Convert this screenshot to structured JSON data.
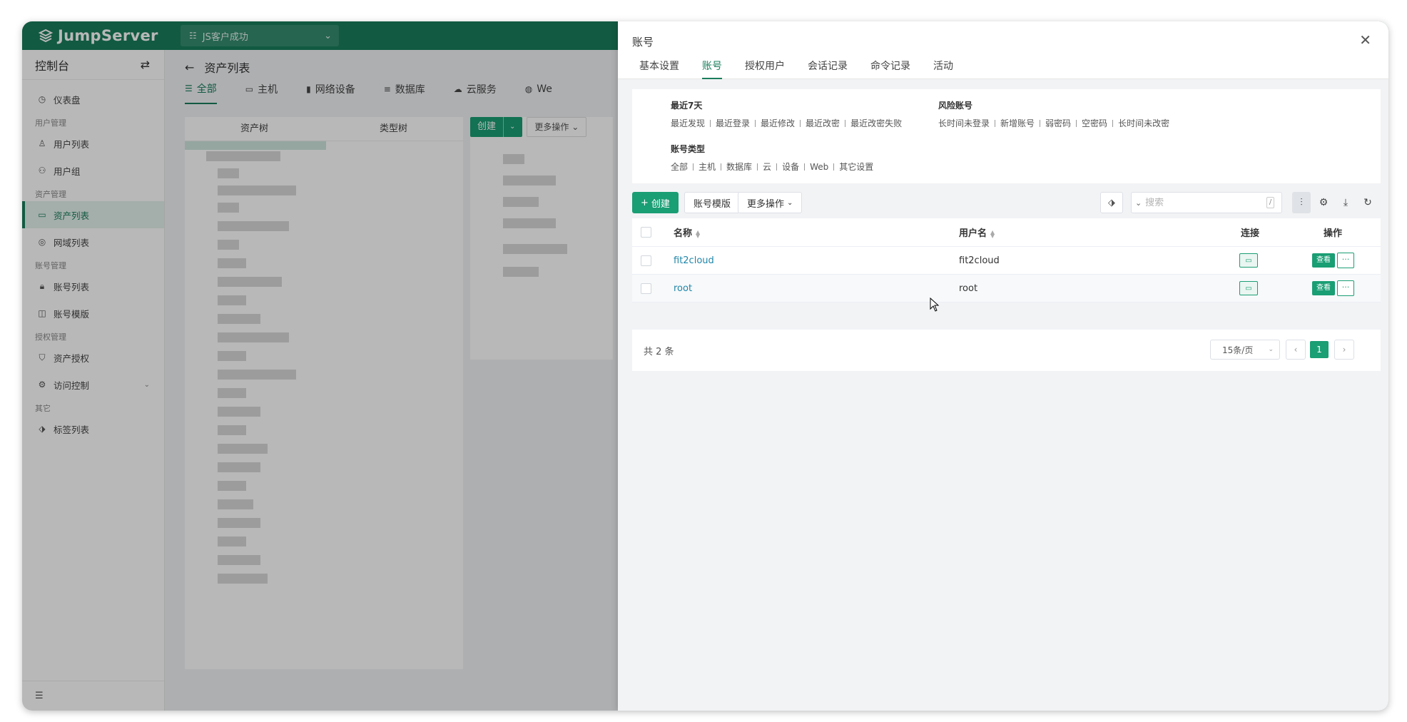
{
  "app": {
    "logo": "JumpServer",
    "org": "JS客户成功"
  },
  "sidebar": {
    "title": "控制台",
    "groups": [
      {
        "label": "",
        "items": [
          {
            "label": "仪表盘",
            "icon": "dashboard-icon"
          }
        ]
      },
      {
        "label": "用户管理",
        "items": [
          {
            "label": "用户列表",
            "icon": "user-icon"
          },
          {
            "label": "用户组",
            "icon": "user-group-icon"
          }
        ]
      },
      {
        "label": "资产管理",
        "items": [
          {
            "label": "资产列表",
            "icon": "asset-icon"
          },
          {
            "label": "网域列表",
            "icon": "domain-icon"
          }
        ]
      },
      {
        "label": "账号管理",
        "items": [
          {
            "label": "账号列表",
            "icon": "lock-icon"
          },
          {
            "label": "账号模版",
            "icon": "template-icon"
          }
        ]
      },
      {
        "label": "授权管理",
        "items": [
          {
            "label": "资产授权",
            "icon": "shield-icon"
          },
          {
            "label": "访问控制",
            "icon": "access-control-icon"
          }
        ]
      },
      {
        "label": "其它",
        "items": [
          {
            "label": "标签列表",
            "icon": "tag-icon"
          }
        ]
      }
    ]
  },
  "page": {
    "breadcrumb": "资产列表",
    "tabs": [
      "全部",
      "主机",
      "网络设备",
      "数据库",
      "云服务",
      "We"
    ],
    "tree_tabs": [
      "资产树",
      "类型树"
    ],
    "create_label": "创建",
    "more_label": "更多操作"
  },
  "drawer": {
    "title": "账号",
    "tabs": [
      "基本设置",
      "账号",
      "授权用户",
      "会话记录",
      "命令记录",
      "活动"
    ],
    "active_tab": "账号",
    "quick_filters": {
      "recent": {
        "title": "最近7天",
        "links": [
          "最近发现",
          "最近登录",
          "最近修改",
          "最近改密",
          "最近改密失败"
        ]
      },
      "risk": {
        "title": "风险账号",
        "links": [
          "长时间未登录",
          "新增账号",
          "弱密码",
          "空密码",
          "长时间未改密"
        ]
      },
      "type": {
        "title": "账号类型",
        "links": [
          "全部",
          "主机",
          "数据库",
          "云",
          "设备",
          "Web",
          "其它设置"
        ]
      }
    },
    "toolbar": {
      "create_label": "创建",
      "template_label": "账号模版",
      "more_label": "更多操作",
      "search_placeholder": "搜索",
      "search_shortcut": "/"
    },
    "table": {
      "headers": {
        "name": "名称",
        "username": "用户名",
        "connect": "连接",
        "actions": "操作"
      },
      "rows": [
        {
          "name": "fit2cloud",
          "username": "fit2cloud",
          "view": "查看",
          "more": "···"
        },
        {
          "name": "root",
          "username": "root",
          "view": "查看",
          "more": "···"
        }
      ]
    },
    "pagination": {
      "total": "共 2 条",
      "page_size": "15条/页",
      "current_page": "1"
    }
  }
}
